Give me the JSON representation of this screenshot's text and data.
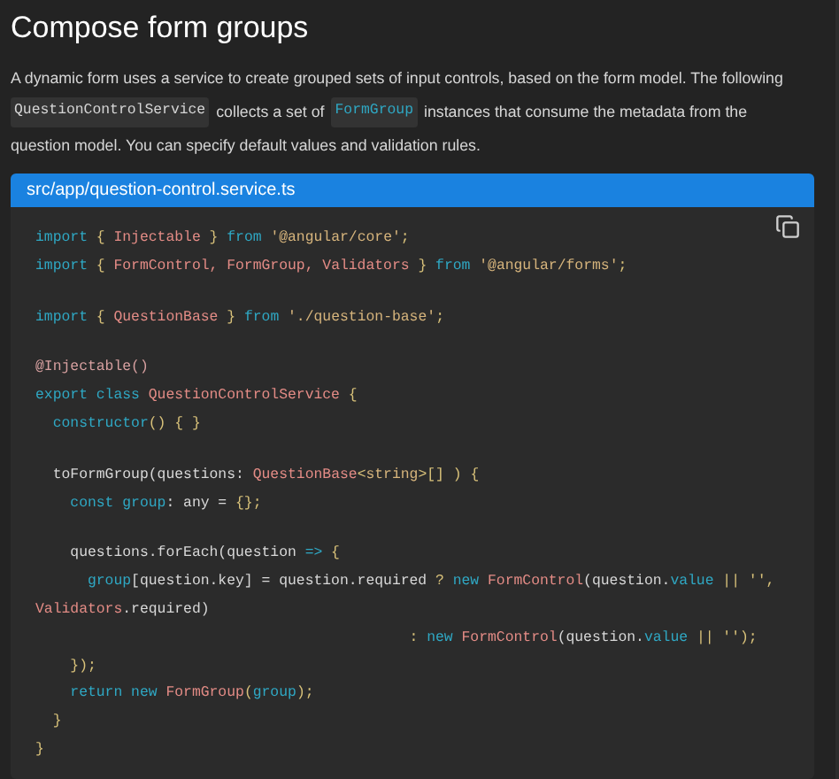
{
  "heading": "Compose form groups",
  "paragraph": [
    [
      {
        "kind": "text",
        "text": "A dynamic form uses a service to create grouped sets of input controls, based on the form model. The following"
      }
    ],
    [
      {
        "kind": "code",
        "text": "QuestionControlService"
      },
      {
        "kind": "text",
        "text": "collects a set of"
      },
      {
        "kind": "link_code",
        "text": "FormGroup"
      },
      {
        "kind": "text",
        "text": "instances that consume the metadata from the"
      }
    ],
    [
      {
        "kind": "text",
        "text": "question model. You can specify default values and validation rules."
      }
    ]
  ],
  "code_block": {
    "filename": "src/app/question-control.service.ts",
    "lines": [
      {
        "kind": "code",
        "tokens": [
          {
            "kind": "kw",
            "text": "import"
          },
          {
            "kind": "punct",
            "text": " { "
          },
          {
            "kind": "name",
            "text": "Injectable"
          },
          {
            "kind": "punct",
            "text": " } "
          },
          {
            "kind": "kw",
            "text": "from"
          },
          {
            "kind": "str",
            "text": " '@angular/core'"
          },
          {
            "kind": "punct",
            "text": ";"
          }
        ]
      },
      {
        "kind": "code",
        "tokens": [
          {
            "kind": "kw",
            "text": "import"
          },
          {
            "kind": "punct",
            "text": " { "
          },
          {
            "kind": "name",
            "text": "FormControl, FormGroup, Validators"
          },
          {
            "kind": "punct",
            "text": " } "
          },
          {
            "kind": "kw",
            "text": "from"
          },
          {
            "kind": "str",
            "text": " '@angular/forms'"
          },
          {
            "kind": "punct",
            "text": ";"
          }
        ]
      },
      {
        "kind": "blank"
      },
      {
        "kind": "code",
        "tokens": [
          {
            "kind": "kw",
            "text": "import"
          },
          {
            "kind": "punct",
            "text": " { "
          },
          {
            "kind": "name",
            "text": "QuestionBase"
          },
          {
            "kind": "punct",
            "text": " } "
          },
          {
            "kind": "kw",
            "text": "from"
          },
          {
            "kind": "str",
            "text": " './question-base'"
          },
          {
            "kind": "punct",
            "text": ";"
          }
        ]
      },
      {
        "kind": "blank"
      },
      {
        "kind": "code",
        "tokens": [
          {
            "kind": "deco",
            "text": "@Injectable()"
          }
        ]
      },
      {
        "kind": "code",
        "tokens": [
          {
            "kind": "kw",
            "text": "export class "
          },
          {
            "kind": "name",
            "text": "QuestionControlService"
          },
          {
            "kind": "punct",
            "text": " {"
          }
        ]
      },
      {
        "kind": "code",
        "tokens": [
          {
            "kind": "kw",
            "text": "  constructor"
          },
          {
            "kind": "punct",
            "text": "() { }"
          }
        ]
      },
      {
        "kind": "blank"
      },
      {
        "kind": "code",
        "tokens": [
          {
            "kind": "plain",
            "text": "  toFormGroup(questions: "
          },
          {
            "kind": "name",
            "text": "QuestionBase"
          },
          {
            "kind": "punct",
            "text": "<"
          },
          {
            "kind": "str",
            "text": "string"
          },
          {
            "kind": "punct",
            "text": ">[] ) {"
          }
        ]
      },
      {
        "kind": "code",
        "tokens": [
          {
            "kind": "kw",
            "text": "    const group"
          },
          {
            "kind": "plain",
            "text": ": any = "
          },
          {
            "kind": "punct",
            "text": "{};"
          }
        ]
      },
      {
        "kind": "blank"
      },
      {
        "kind": "code",
        "tokens": [
          {
            "kind": "plain",
            "text": "    questions.forEach(question "
          },
          {
            "kind": "kw",
            "text": "=>"
          },
          {
            "kind": "punct",
            "text": " {"
          }
        ]
      },
      {
        "kind": "code",
        "tokens": [
          {
            "kind": "kw",
            "text": "      group"
          },
          {
            "kind": "plain",
            "text": "[question.key] = question.required "
          },
          {
            "kind": "punct",
            "text": "? "
          },
          {
            "kind": "kw",
            "text": "new "
          },
          {
            "kind": "name",
            "text": "FormControl"
          },
          {
            "kind": "plain",
            "text": "(question."
          },
          {
            "kind": "kw",
            "text": "value"
          },
          {
            "kind": "punct",
            "text": " || '',"
          }
        ]
      },
      {
        "kind": "code",
        "tokens": [
          {
            "kind": "name",
            "text": "Validators"
          },
          {
            "kind": "plain",
            "text": ".required)"
          }
        ]
      },
      {
        "kind": "code",
        "tokens": [
          {
            "kind": "punct",
            "text": "                                           : "
          },
          {
            "kind": "kw",
            "text": "new "
          },
          {
            "kind": "name",
            "text": "FormControl"
          },
          {
            "kind": "plain",
            "text": "(question."
          },
          {
            "kind": "kw",
            "text": "value"
          },
          {
            "kind": "punct",
            "text": " || '');"
          }
        ]
      },
      {
        "kind": "code",
        "tokens": [
          {
            "kind": "punct",
            "text": "    });"
          }
        ]
      },
      {
        "kind": "code",
        "tokens": [
          {
            "kind": "kw",
            "text": "    return new "
          },
          {
            "kind": "name",
            "text": "FormGroup"
          },
          {
            "kind": "punct",
            "text": "("
          },
          {
            "kind": "kw",
            "text": "group"
          },
          {
            "kind": "punct",
            "text": ");"
          }
        ]
      },
      {
        "kind": "code",
        "tokens": [
          {
            "kind": "punct",
            "text": "  }"
          }
        ]
      },
      {
        "kind": "code",
        "tokens": [
          {
            "kind": "punct",
            "text": "}"
          }
        ]
      }
    ]
  }
}
